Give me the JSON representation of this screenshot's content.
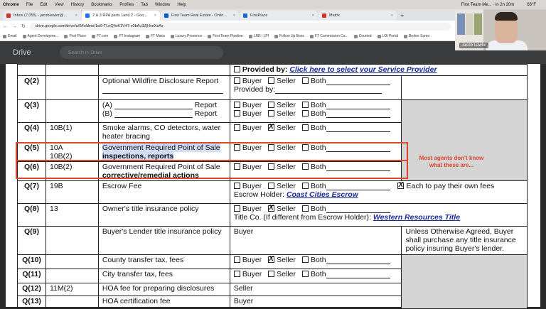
{
  "menubar": {
    "app": "Chrome",
    "items": [
      "File",
      "Edit",
      "View",
      "History",
      "Bookmarks",
      "Profiles",
      "Tab",
      "Window",
      "Help"
    ],
    "notification": "First Team Me... · in 2h 20m",
    "temperature": "66°F"
  },
  "tabs": [
    {
      "label": "Inbox (7,055) - jacoblawlor@...",
      "color": "#d93025"
    },
    {
      "label": "2 & 3 RPA parts 1and 2 - Goo...",
      "color": "#1a73e8"
    },
    {
      "label": "First Team Real Estate - Onlin...",
      "color": "#0b57d0"
    },
    {
      "label": "FirstPlace",
      "color": "#1967d2"
    },
    {
      "label": "Matrix",
      "color": "#d93025"
    }
  ],
  "address": {
    "url": "drive.google.com/drive/u/0/folders/1w9-TLnQhvK1V47-x0bAu3ZjHveXsAz"
  },
  "bookmarks": [
    "Email",
    "Agent Developme...",
    "First Place",
    "FT.com",
    "FT Instagram",
    "FT Maxa",
    "Luxury Presence",
    "First Team Pipeline",
    "LRE / LPI",
    "Follow Up Boss",
    "FT Commission Ca...",
    "Courted",
    "LOI Portal",
    "Broker Sumo"
  ],
  "drive": {
    "logo_text": "Drive",
    "search_placeholder": "Search in Drive"
  },
  "video": {
    "participant_name": "Jacob Lawlor"
  },
  "form": {
    "row_top": {
      "provided_by_label": "Provided by:",
      "link": "Click here to select your Service Provider"
    },
    "rows": [
      {
        "q": "Q(2)",
        "para": "",
        "item": "Optional Wildfire Disclosure Report"
      },
      {
        "q": "Q(3)",
        "para": "",
        "item_a": "(A)",
        "item_b": "(B)",
        "report": "Report"
      },
      {
        "q": "Q(4)",
        "para": "10B(1)",
        "item": "Smoke alarms, CO detectors, water heater bracing"
      },
      {
        "q": "Q(5)",
        "para": "10A",
        "para2": "10B(2)",
        "item": "Government Required Point of Sale",
        "item_bold": "inspections, reports"
      },
      {
        "q": "Q(6)",
        "para": "10B(2)",
        "item": "Government Required Point of Sale",
        "item_bold": "corrective/remedial actions"
      },
      {
        "q": "Q(7)",
        "para": "19B",
        "item": "Escrow Fee"
      },
      {
        "q": "Q(8)",
        "para": "13",
        "item": "Owner's title insurance policy"
      },
      {
        "q": "Q(9)",
        "para": "",
        "item": "Buyer's Lender title insurance policy"
      },
      {
        "q": "Q(10)",
        "para": "",
        "item": "County transfer tax, fees"
      },
      {
        "q": "Q(11)",
        "para": "",
        "item": "City transfer tax, fees"
      },
      {
        "q": "Q(12)",
        "para": "11M(2)",
        "item": "HOA fee for preparing disclosures"
      },
      {
        "q": "Q(13)",
        "para": "",
        "item": "HOA certification fee"
      }
    ],
    "labels": {
      "buyer": "Buyer",
      "seller": "Seller",
      "both": "Both",
      "provided_by": "Provided by:"
    },
    "escrow_each": "Each to pay their own fees",
    "escrow_holder_label": "Escrow Holder:",
    "escrow_holder": "Coast Cities Escrow",
    "title_co_label": "Title Co. (If different from Escrow Holder):",
    "title_co": "Western Resources Title",
    "q9_payer": "Buyer",
    "q9_note": "Unless Otherwise Agreed, Buyer shall purchase any title insurance policy insuring Buyer's lender.",
    "q12_payer": "Seller",
    "q13_payer": "Buyer"
  },
  "annotation": {
    "text": "Most agents don't know what these are...",
    "color": "#e0452e"
  }
}
